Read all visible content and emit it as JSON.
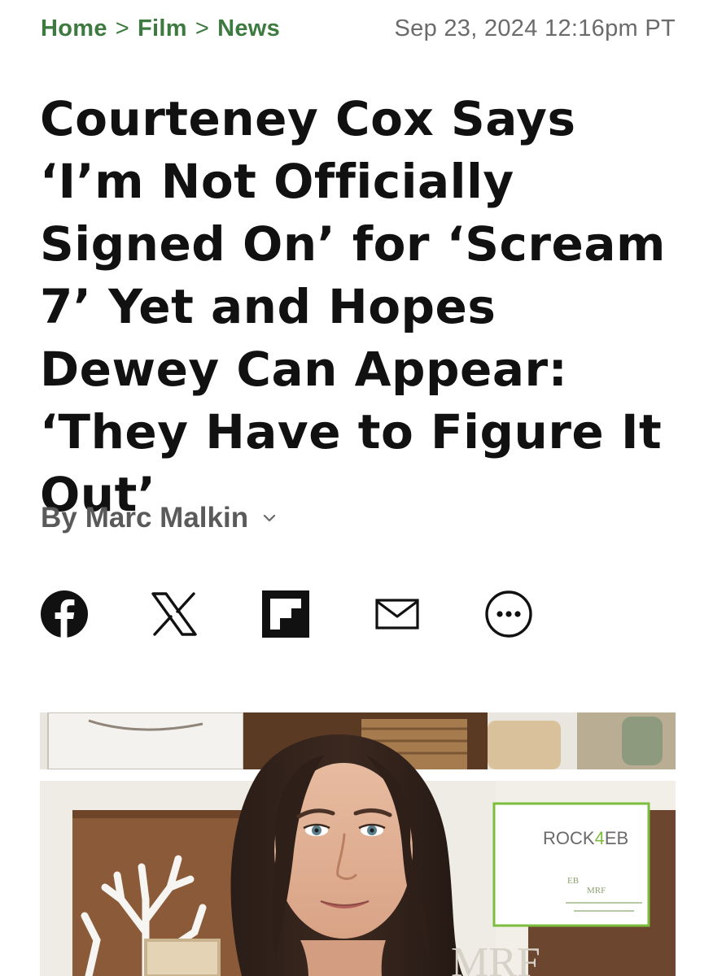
{
  "breadcrumb": {
    "items": [
      "Home",
      "Film",
      "News"
    ],
    "separator": ">"
  },
  "timestamp": "Sep 23, 2024 12:16pm PT",
  "headline": "Courteney Cox Says ‘I’m Not Officially Signed On’ for ‘Scream 7’ Yet and Hopes Dewey Can Appear: ‘They Have to Figure It Out’",
  "byline": {
    "prefix": "By",
    "author": "Marc Malkin"
  },
  "share": {
    "icons": [
      "facebook-icon",
      "x-icon",
      "flipboard-icon",
      "email-icon",
      "more-icon"
    ]
  },
  "hero_image": {
    "sign_brand_prefix": "ROCK",
    "sign_brand_digit": "4",
    "sign_brand_suffix": "EB",
    "sign_logo_left": "EB",
    "sign_logo_right": "MRF",
    "backdrop_letters": "MRF"
  },
  "colors": {
    "accent": "#3d7a3f",
    "meta_text": "#6b6b6b",
    "headline": "#111111",
    "sign_green": "#7cbd3e"
  }
}
